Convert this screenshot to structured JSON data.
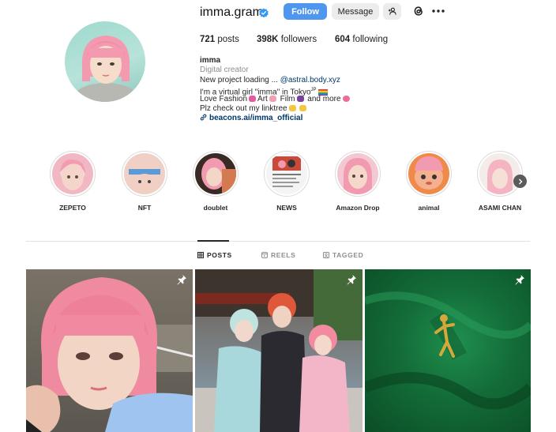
{
  "profile": {
    "username": "imma.gram",
    "follow_label": "Follow",
    "message_label": "Message",
    "add_user_glyph": "+↑"
  },
  "stats": {
    "posts_count": "721",
    "posts_label": "posts",
    "followers_count": "398K",
    "followers_label": "followers",
    "following_count": "604",
    "following_label": "following"
  },
  "bio": {
    "name": "imma",
    "category": "Digital creator",
    "line1_text": "New project loading ... ",
    "line1_mention": "@astral.body.xyz",
    "line2": "I'm a virtual girl \"imma\" in Tokyo",
    "line2_suffix": "JP",
    "line3_a": "Love Fashion",
    "line3_b": "Art",
    "line3_c": "Film",
    "line3_d": "and more",
    "line4": "Plz check out my linktree",
    "link": "beacons.ai/imma_official"
  },
  "highlights": [
    {
      "label": "ZEPETO",
      "icon": "highlight-zepeto"
    },
    {
      "label": "NFT",
      "icon": "highlight-nft"
    },
    {
      "label": "doublet",
      "icon": "highlight-doublet"
    },
    {
      "label": "NEWS",
      "icon": "highlight-news"
    },
    {
      "label": "Amazon Drop",
      "icon": "highlight-amazon-drop"
    },
    {
      "label": "animal",
      "icon": "highlight-animal"
    },
    {
      "label": "ASAMI CHAN",
      "icon": "highlight-asami-chan"
    }
  ],
  "tabs": [
    {
      "label": "POSTS",
      "icon": "grid-icon",
      "active": true
    },
    {
      "label": "REELS",
      "icon": "reels-icon",
      "active": false
    },
    {
      "label": "TAGGED",
      "icon": "tagged-icon",
      "active": false
    }
  ],
  "posts": [
    {
      "icon": "pinned-icon",
      "pinned": true
    },
    {
      "icon": "pinned-icon",
      "pinned": true
    },
    {
      "icon": "pinned-icon",
      "pinned": true
    }
  ],
  "colors": {
    "accent": "#4f97ee",
    "link": "#00376b",
    "verified": "#3897f0",
    "text": "#262626",
    "muted": "#8e8e8e"
  }
}
